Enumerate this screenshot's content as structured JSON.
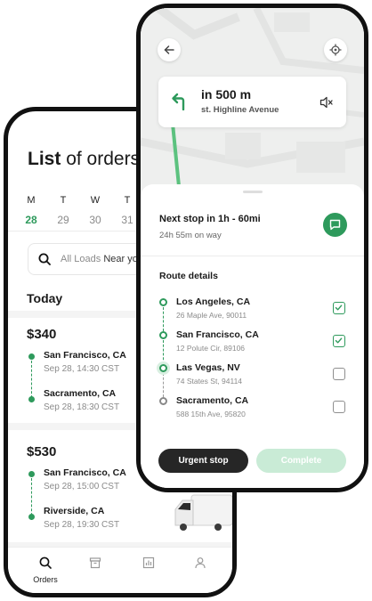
{
  "orders_screen": {
    "title_bold": "List",
    "title_rest": "of orders",
    "week": [
      {
        "day": "M",
        "date": "28",
        "active": true
      },
      {
        "day": "T",
        "date": "29",
        "active": false
      },
      {
        "day": "W",
        "date": "30",
        "active": false
      },
      {
        "day": "T",
        "date": "31",
        "active": false
      }
    ],
    "search": {
      "prefix": "All Loads",
      "value": "Near you"
    },
    "section": "Today",
    "orders": [
      {
        "price": "$340",
        "pickup_city": "San Francisco, CA",
        "pickup_time": "Sep 28, 14:30 CST",
        "dropoff_city": "Sacramento, CA",
        "dropoff_time": "Sep 28, 18:30 CST"
      },
      {
        "price": "$530",
        "pickup_city": "San Francisco, CA",
        "pickup_time": "Sep 28, 15:00 CST",
        "dropoff_city": "Riverside, CA",
        "dropoff_time": "Sep 28, 19:30 CST"
      }
    ],
    "bottom_nav": [
      {
        "icon": "search-icon",
        "label": "Orders"
      },
      {
        "icon": "archive-icon",
        "label": ""
      },
      {
        "icon": "chart-icon",
        "label": ""
      },
      {
        "icon": "user-icon",
        "label": ""
      }
    ]
  },
  "navigation_screen": {
    "instruction": {
      "distance": "in 500 m",
      "street": "st. Highline Avenue",
      "icon": "turn-left-icon"
    },
    "next_stop": "Next stop in 1h - 60mi",
    "time_on_way": "24h 55m on way",
    "route_title": "Route details",
    "stops": [
      {
        "city": "Los Angeles, CA",
        "address": "26 Maple Ave, 90011",
        "checked": true
      },
      {
        "city": "San Francisco, CA",
        "address": "12 Polute Cir, 89106",
        "checked": true
      },
      {
        "city": "Las Vegas, NV",
        "address": "74 States St, 94114",
        "checked": false
      },
      {
        "city": "Sacramento, CA",
        "address": "588 15th Ave, 95820",
        "checked": false
      }
    ],
    "buttons": {
      "urgent": "Urgent stop",
      "complete": "Complete"
    },
    "colors": {
      "accent": "#2e9a5c",
      "accent_light": "#c9ebd6",
      "dark": "#262626"
    }
  }
}
